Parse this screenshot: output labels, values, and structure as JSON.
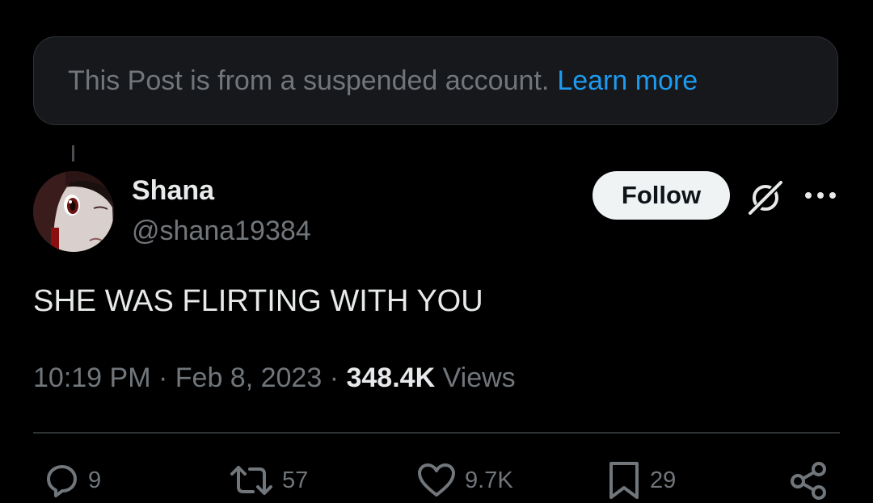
{
  "notice": {
    "text": "This Post is from a suspended account.",
    "link": "Learn more"
  },
  "author": {
    "display_name": "Shana",
    "handle": "@shana19384",
    "avatar_icon": "anime-girl-avatar"
  },
  "header_actions": {
    "follow_label": "Follow",
    "grok_icon": "grok-icon",
    "more_icon": "more-horizontal-icon"
  },
  "post": {
    "text": "SHE WAS FLIRTING WITH YOU",
    "time": "10:19 PM",
    "date": "Feb 8, 2023",
    "views_count": "348.4K",
    "views_label": "Views"
  },
  "actions": {
    "replies": "9",
    "reposts": "57",
    "likes": "9.7K",
    "bookmarks": "29"
  },
  "colors": {
    "background": "#000000",
    "text_primary": "#e7e9ea",
    "text_secondary": "#71767b",
    "link": "#1d9bf0",
    "notice_bg": "#16181c",
    "border": "#2f3336"
  }
}
